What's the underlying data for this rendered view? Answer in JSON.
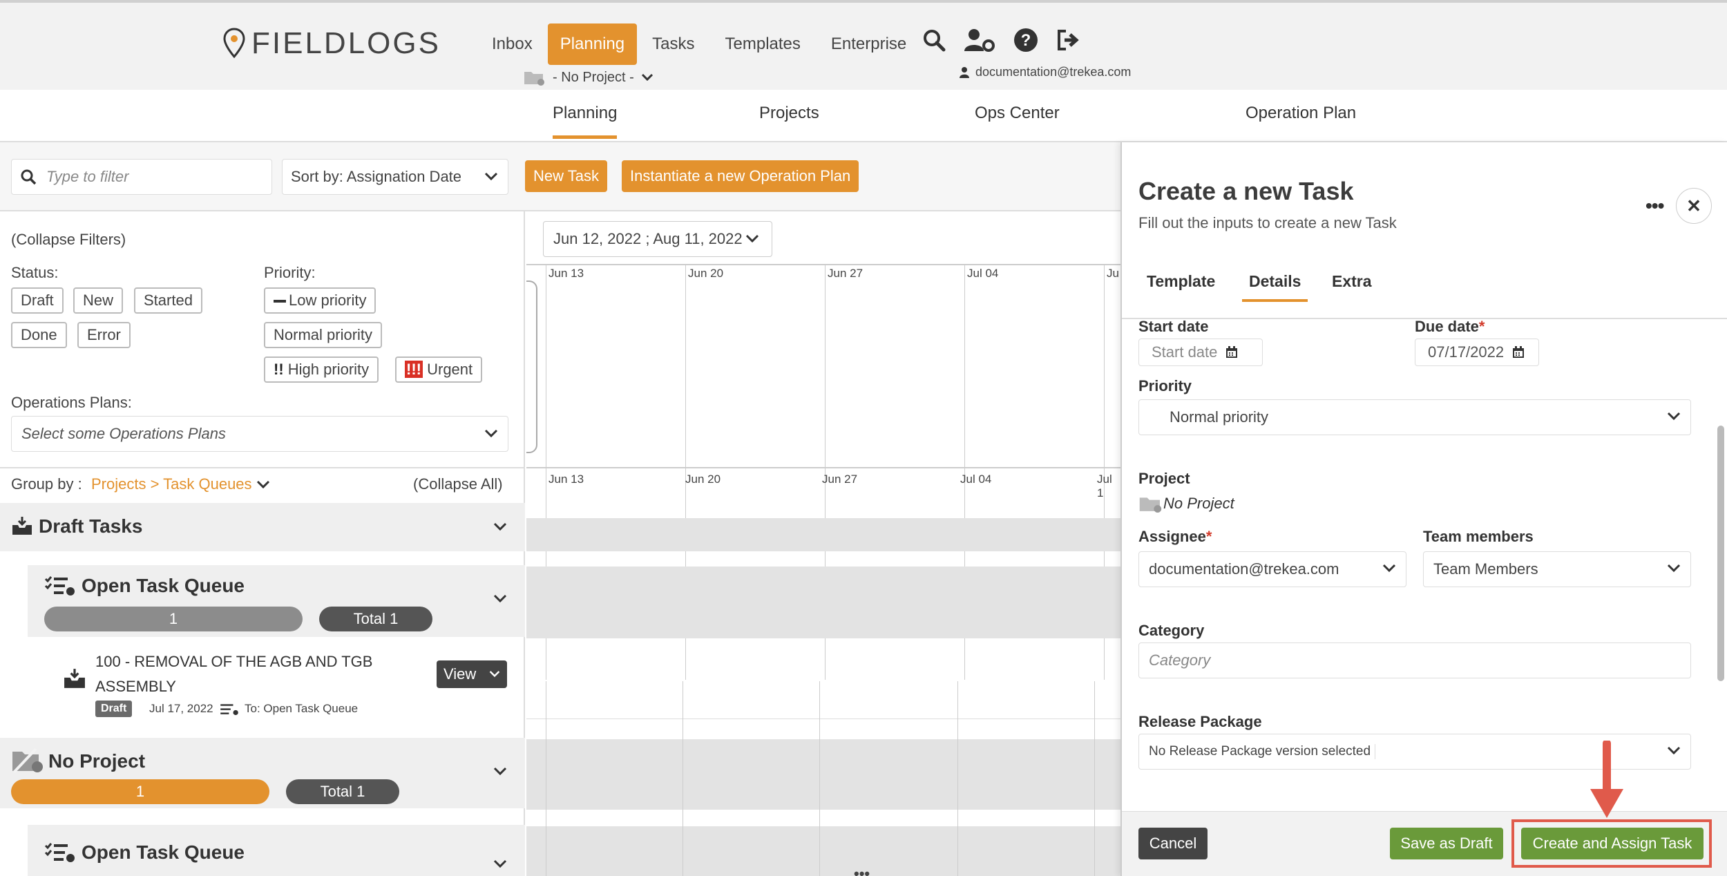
{
  "app": {
    "logo_text": "FIELDLOGS"
  },
  "nav": {
    "items": [
      {
        "label": "Inbox"
      },
      {
        "label": "Planning",
        "active": true
      },
      {
        "label": "Tasks"
      },
      {
        "label": "Templates"
      },
      {
        "label": "Enterprise"
      }
    ],
    "project_selector": "- No Project -",
    "user_email": "documentation@trekea.com"
  },
  "subtabs": [
    "Planning",
    "Projects",
    "Ops Center",
    "Operation Plan"
  ],
  "toolbar": {
    "filter_placeholder": "Type to filter",
    "sort_label": "Sort by: Assignation Date",
    "new_task": "New Task",
    "instantiate_plan": "Instantiate a new Operation Plan"
  },
  "filters": {
    "collapse": "(Collapse Filters)",
    "status_label": "Status:",
    "statuses": [
      "Draft",
      "New",
      "Started",
      "Done",
      "Error"
    ],
    "priority_label": "Priority:",
    "priorities": [
      "Low priority",
      "Normal priority",
      "High priority",
      "Urgent"
    ],
    "ops_plans_label": "Operations Plans:",
    "ops_plans_placeholder": "Select some Operations Plans"
  },
  "grouping": {
    "group_by_label": "Group by :",
    "group_by_value": "Projects > Task Queues",
    "collapse_all": "(Collapse All)"
  },
  "groups": {
    "draft_title": "Draft Tasks",
    "queue_title": "Open Task Queue",
    "queue_count": "1",
    "queue_total": "Total 1",
    "task_title": "100 - REMOVAL OF THE AGB AND TGB ASSEMBLY",
    "task_status": "Draft",
    "task_date": "Jul 17, 2022",
    "task_queue": "To: Open Task Queue",
    "task_view": "View",
    "noproject_title": "No Project",
    "noproject_count": "1",
    "noproject_total": "Total 1",
    "queue2_title": "Open Task Queue"
  },
  "timeline": {
    "range": "Jun 12, 2022 ; Aug 11, 2022",
    "weeks_top": [
      "Jun 13",
      "Jun 20",
      "Jun 27",
      "Jul 04",
      "Ju"
    ],
    "weeks_bottom": [
      "Jun 13",
      "Jun 20",
      "Jun 27",
      "Jul 04",
      "Jul 1"
    ]
  },
  "panel": {
    "title": "Create a new Task",
    "subtitle": "Fill out the inputs to create a new Task",
    "tabs": [
      "Template",
      "Details",
      "Extra"
    ],
    "start_date_label": "Start date",
    "start_date_placeholder": "Start date",
    "due_date_label": "Due date",
    "due_date_value": "07/17/2022",
    "priority_label": "Priority",
    "priority_value": "Normal priority",
    "project_label": "Project",
    "project_value": "No Project",
    "assignee_label": "Assignee",
    "assignee_value": "documentation@trekea.com",
    "team_label": "Team members",
    "team_value": "Team Members",
    "category_label": "Category",
    "category_placeholder": "Category",
    "release_label": "Release Package",
    "release_value": "No Release Package version selected",
    "cancel": "Cancel",
    "save_draft": "Save as Draft",
    "create_assign": "Create and Assign Task"
  },
  "colors": {
    "accent": "#e3922e",
    "green": "#6a9a3a",
    "dark": "#444444",
    "highlight": "#e05a4b"
  }
}
